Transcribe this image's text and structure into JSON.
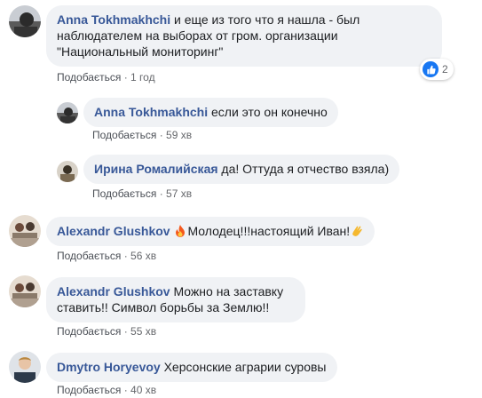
{
  "colors": {
    "author": "#385898",
    "bubble": "#f0f2f5",
    "meta": "#65676b",
    "like": "#1877f2"
  },
  "comments": [
    {
      "author": "Anna Tokhmakhchi",
      "text": "и еще из того что я нашла - был наблюдателем на выборах от гром. организации \"Национальный мониторинг\"",
      "like_label": "Подобається",
      "time": "1 год",
      "reactions": {
        "icon": "like-icon",
        "count": "2"
      }
    },
    {
      "author": "Anna Tokhmakhchi",
      "text": "если это он конечно",
      "like_label": "Подобається",
      "time": "59 хв"
    },
    {
      "author": "Ирина Ромалийская",
      "text": "да! Оттуда я отчество взяла)",
      "like_label": "Подобається",
      "time": "57 хв"
    },
    {
      "author": "Alexandr Glushkov",
      "text_before": "Молодец!!!настоящий Иван!",
      "emoji_before": "fire-emoji",
      "emoji_after": "clap-emoji",
      "like_label": "Подобається",
      "time": "56 хв"
    },
    {
      "author": "Alexandr Glushkov",
      "text": "Можно на заставку ставить!! Символ борьбы за Землю!!",
      "like_label": "Подобається",
      "time": "55 хв"
    },
    {
      "author": "Dmytro Horyevoy",
      "text": "Херсонские аграрии суровы",
      "like_label": "Подобається",
      "time": "40 хв"
    }
  ],
  "separator": "·"
}
